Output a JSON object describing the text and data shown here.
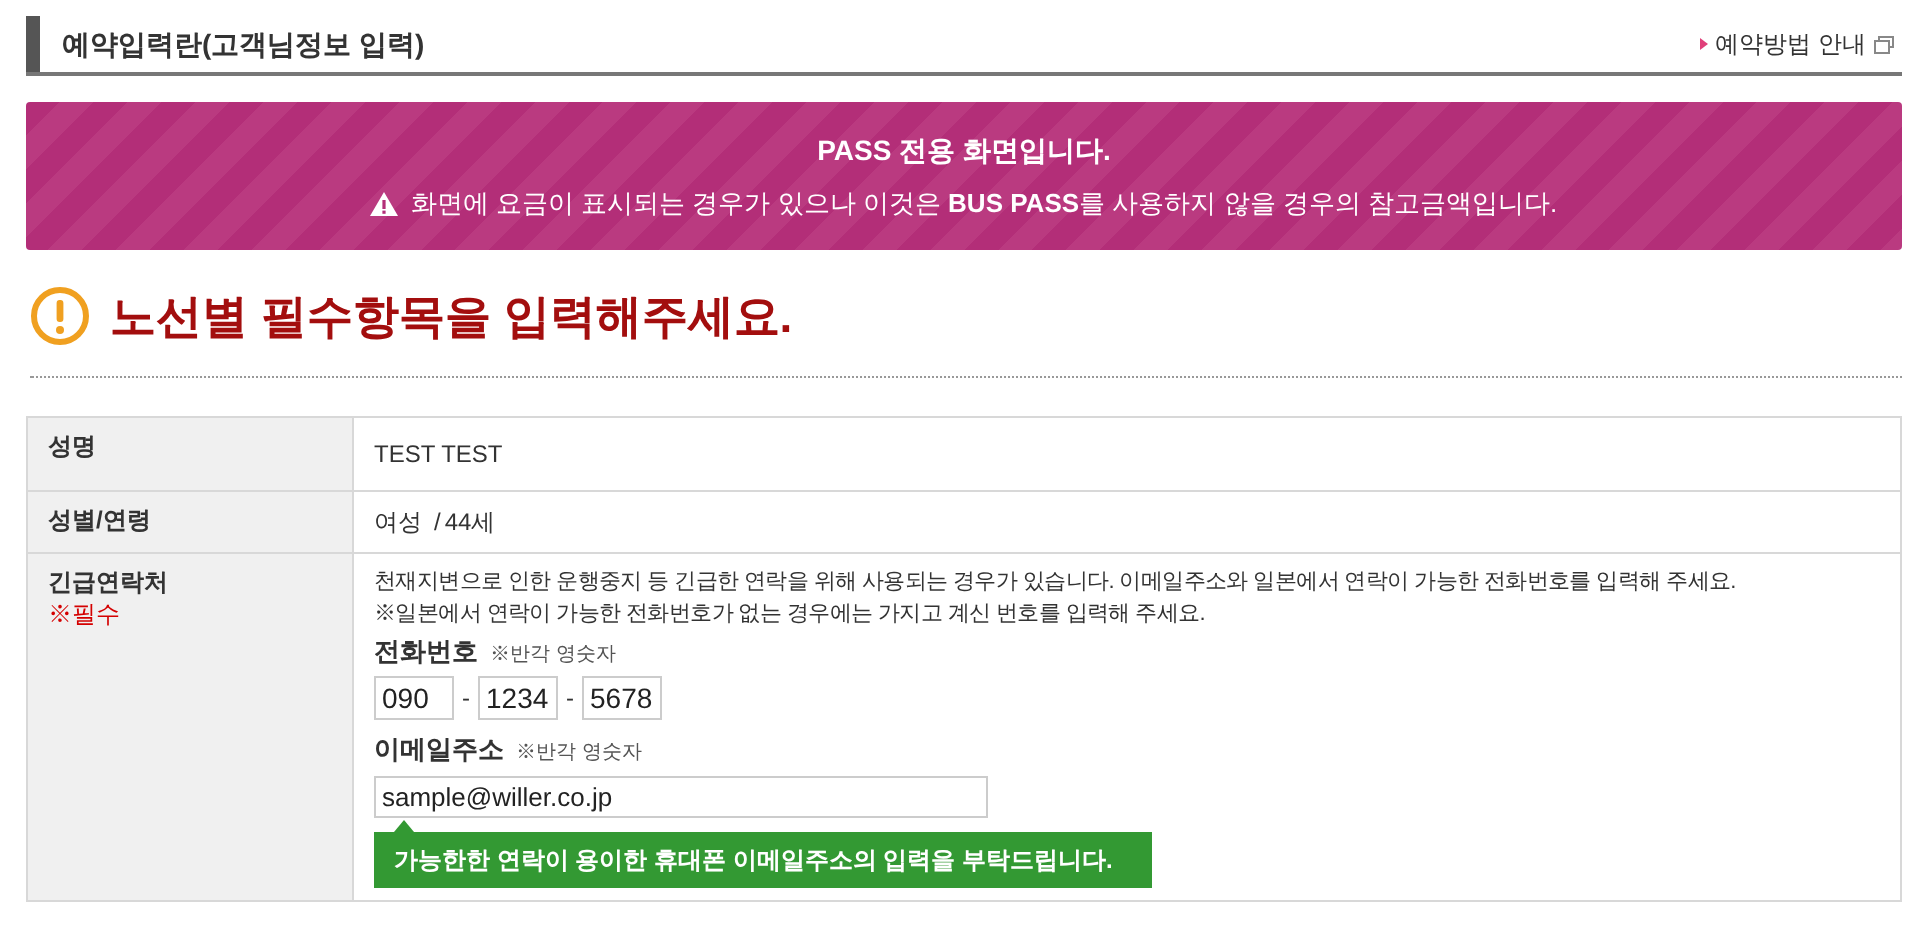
{
  "header": {
    "title": "예약입력란(고객님정보 입력)",
    "guide_link": "예약방법 안내"
  },
  "banner": {
    "title": "PASS 전용 화면입니다.",
    "note": "화면에 요금이 표시되는 경우가 있으나 이것은 **BUS PASS**를 사용하지 않을 경우의 참고금액입니다."
  },
  "notice": {
    "text": "노선별 필수항목을 입력해주세요."
  },
  "form": {
    "rows": [
      {
        "kind": "text",
        "label": "성명",
        "value": "TEST TEST"
      },
      {
        "kind": "gender_age",
        "label": "성별/연령",
        "gender": "여성",
        "separator": "/",
        "age": "44세"
      },
      {
        "kind": "contact",
        "label": "긴급연락처",
        "required": "※필수",
        "description": "천재지변으로 인한 운행중지 등 긴급한 연락을 위해 사용되는 경우가 있습니다. 이메일주소와 일본에서 연락이 가능한 전화번호를 입력해 주세요.",
        "description_2": "※일본에서 연락이 가능한 전화번호가 없는 경우에는 가지고 계신 번호를 입력해 주세요.",
        "phone": {
          "label": "전화번호",
          "hint": "※반각 영숫자",
          "parts": [
            "090",
            "1234",
            "5678"
          ],
          "separators": [
            "-",
            "-"
          ]
        },
        "email": {
          "label": "이메일주소",
          "hint": "※반각 영숫자",
          "value": "sample@willer.co.jp",
          "tooltip": "가능한한 연락이 용이한 휴대폰 이메일주소의 입력을 부탁드립니다."
        }
      }
    ]
  }
}
